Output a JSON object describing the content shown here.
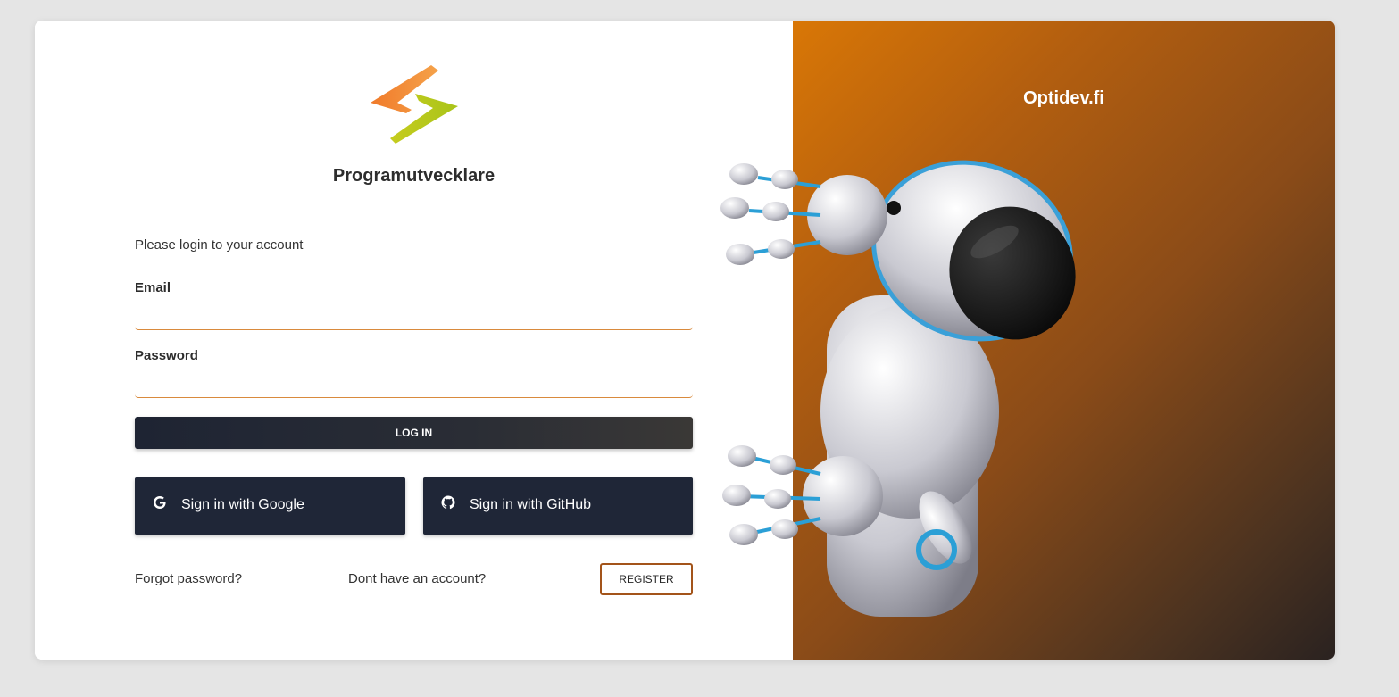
{
  "brand": {
    "name": "Programutvecklare"
  },
  "hero": {
    "title": "Optidev.fi"
  },
  "login": {
    "subtitle": "Please login to your account",
    "email_label": "Email",
    "email_value": "",
    "password_label": "Password",
    "password_value": "",
    "login_button": "LOG IN"
  },
  "social": {
    "google_label": "Sign in with Google",
    "google_icon": "google-icon",
    "github_label": "Sign in with GitHub",
    "github_icon": "github-icon"
  },
  "footer": {
    "forgot_password": "Forgot password?",
    "no_account": "Dont have an account?",
    "register_button": "REGISTER"
  },
  "colors": {
    "accent": "#d98a3d",
    "dark_button": "#1f2637",
    "register_border": "#a3541a",
    "gradient_start": "#d97706",
    "gradient_end": "#2a2220"
  }
}
